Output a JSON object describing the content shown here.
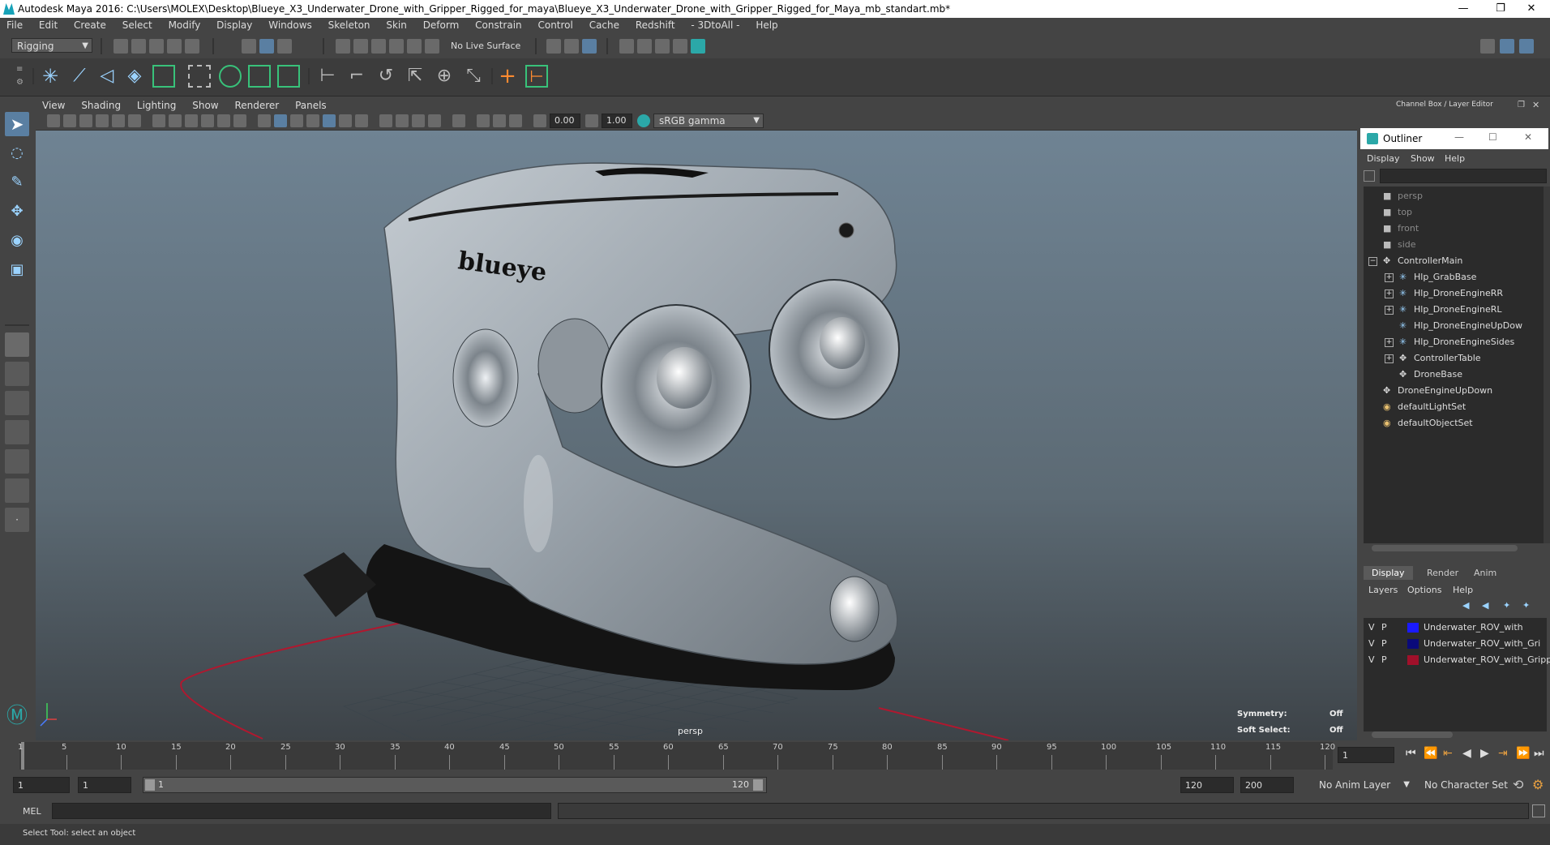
{
  "window": {
    "title": "Autodesk Maya 2016: C:\\Users\\MOLEX\\Desktop\\Blueye_X3_Underwater_Drone_with_Gripper_Rigged_for_maya\\Blueye_X3_Underwater_Drone_with_Gripper_Rigged_for_Maya_mb_standart.mb*",
    "minimize": "—",
    "restore": "❐",
    "close": "✕"
  },
  "menubar": [
    "File",
    "Edit",
    "Create",
    "Select",
    "Modify",
    "Display",
    "Windows",
    "Skeleton",
    "Skin",
    "Deform",
    "Constrain",
    "Control",
    "Cache",
    "Redshift",
    "- 3DtoAll -",
    "Help"
  ],
  "statusline": {
    "mode": "Rigging",
    "live_surface": "No Live Surface"
  },
  "viewport": {
    "menus": [
      "View",
      "Shading",
      "Lighting",
      "Show",
      "Renderer",
      "Panels"
    ],
    "exposure": "0.00",
    "gamma": "1.00",
    "colorspace": "sRGB gamma",
    "camera_label": "persp",
    "brand_text": "blueye",
    "symmetry_label": "Symmetry:",
    "symmetry_value": "Off",
    "soft_select_label": "Soft Select:",
    "soft_select_value": "Off"
  },
  "channel_box": {
    "title": "Channel Box / Layer Editor"
  },
  "outliner": {
    "title": "Outliner",
    "menus": [
      "Display",
      "Show",
      "Help"
    ],
    "items": [
      {
        "label": "persp",
        "indent": 0,
        "icon": "camera",
        "dim": true,
        "expander": ""
      },
      {
        "label": "top",
        "indent": 0,
        "icon": "camera",
        "dim": true,
        "expander": ""
      },
      {
        "label": "front",
        "indent": 0,
        "icon": "camera",
        "dim": true,
        "expander": ""
      },
      {
        "label": "side",
        "indent": 0,
        "icon": "camera",
        "dim": true,
        "expander": ""
      },
      {
        "label": "ControllerMain",
        "indent": 0,
        "icon": "transform",
        "dim": false,
        "expander": "−"
      },
      {
        "label": "Hlp_GrabBase",
        "indent": 1,
        "icon": "joint",
        "dim": false,
        "expander": "+"
      },
      {
        "label": "Hlp_DroneEngineRR",
        "indent": 1,
        "icon": "joint",
        "dim": false,
        "expander": "+"
      },
      {
        "label": "Hlp_DroneEngineRL",
        "indent": 1,
        "icon": "joint",
        "dim": false,
        "expander": "+"
      },
      {
        "label": "Hlp_DroneEngineUpDow",
        "indent": 1,
        "icon": "joint",
        "dim": false,
        "expander": ""
      },
      {
        "label": "Hlp_DroneEngineSides",
        "indent": 1,
        "icon": "joint",
        "dim": false,
        "expander": "+"
      },
      {
        "label": "ControllerTable",
        "indent": 1,
        "icon": "transform",
        "dim": false,
        "expander": "+"
      },
      {
        "label": "DroneBase",
        "indent": 1,
        "icon": "transform",
        "dim": false,
        "expander": ""
      },
      {
        "label": "DroneEngineUpDown",
        "indent": 0,
        "icon": "transform",
        "dim": false,
        "expander": ""
      },
      {
        "label": "defaultLightSet",
        "indent": 0,
        "icon": "set",
        "dim": false,
        "expander": ""
      },
      {
        "label": "defaultObjectSet",
        "indent": 0,
        "icon": "set",
        "dim": false,
        "expander": ""
      }
    ]
  },
  "layer_editor": {
    "tabs": [
      "Display",
      "Render",
      "Anim"
    ],
    "active_tab": "Display",
    "menus": [
      "Layers",
      "Options",
      "Help"
    ],
    "layers": [
      {
        "v": "V",
        "p": "P",
        "color": "#1a1aff",
        "name": "Underwater_ROV_with"
      },
      {
        "v": "V",
        "p": "P",
        "color": "#0a0a7a",
        "name": "Underwater_ROV_with_Gri"
      },
      {
        "v": "V",
        "p": "P",
        "color": "#a0102a",
        "name": "Underwater_ROV_with_Gripp"
      }
    ]
  },
  "timeline": {
    "ticks": [
      "1",
      "5",
      "10",
      "15",
      "20",
      "25",
      "30",
      "35",
      "40",
      "45",
      "50",
      "55",
      "60",
      "65",
      "70",
      "75",
      "80",
      "85",
      "90",
      "95",
      "100",
      "105",
      "110",
      "115",
      "120"
    ],
    "current_frame": "1"
  },
  "range": {
    "start": "1",
    "playback_start": "1",
    "slider_start": "1",
    "slider_end": "120",
    "playback_end": "120",
    "end": "200",
    "anim_layer": "No Anim Layer",
    "character_set": "No Character Set"
  },
  "cmdline": {
    "label": "MEL"
  },
  "helpline": {
    "text": "Select Tool: select an object"
  }
}
